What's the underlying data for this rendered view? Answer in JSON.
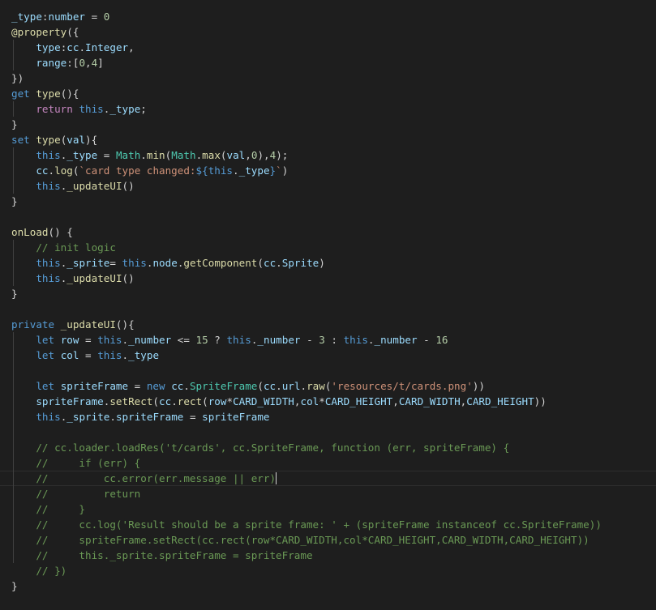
{
  "colors": {
    "default": "#d4d4d4",
    "variable": "#9cdcfe",
    "keyword": "#569cd6",
    "control": "#c586c0",
    "function": "#dcdcaa",
    "type": "#4ec9b0",
    "number": "#b5cea8",
    "string": "#ce9178",
    "comment": "#6a9955"
  },
  "code": {
    "lines": [
      [
        [
          "variable",
          "_type"
        ],
        [
          "default",
          ":"
        ],
        [
          "variable",
          "number"
        ],
        [
          "default",
          " = "
        ],
        [
          "number",
          "0"
        ]
      ],
      [
        [
          "function",
          "@property"
        ],
        [
          "default",
          "({"
        ]
      ],
      [
        [
          "default",
          "    "
        ],
        [
          "variable",
          "type"
        ],
        [
          "default",
          ":"
        ],
        [
          "variable",
          "cc"
        ],
        [
          "default",
          "."
        ],
        [
          "variable",
          "Integer"
        ],
        [
          "default",
          ","
        ]
      ],
      [
        [
          "default",
          "    "
        ],
        [
          "variable",
          "range"
        ],
        [
          "default",
          ":["
        ],
        [
          "number",
          "0"
        ],
        [
          "default",
          ","
        ],
        [
          "number",
          "4"
        ],
        [
          "default",
          "]"
        ]
      ],
      [
        [
          "default",
          "})"
        ]
      ],
      [
        [
          "keyword",
          "get"
        ],
        [
          "default",
          " "
        ],
        [
          "function",
          "type"
        ],
        [
          "default",
          "(){"
        ]
      ],
      [
        [
          "default",
          "    "
        ],
        [
          "control",
          "return"
        ],
        [
          "default",
          " "
        ],
        [
          "keyword",
          "this"
        ],
        [
          "default",
          "."
        ],
        [
          "variable",
          "_type"
        ],
        [
          "default",
          ";"
        ]
      ],
      [
        [
          "default",
          "}"
        ]
      ],
      [
        [
          "keyword",
          "set"
        ],
        [
          "default",
          " "
        ],
        [
          "function",
          "type"
        ],
        [
          "default",
          "("
        ],
        [
          "variable",
          "val"
        ],
        [
          "default",
          "){"
        ]
      ],
      [
        [
          "default",
          "    "
        ],
        [
          "keyword",
          "this"
        ],
        [
          "default",
          "."
        ],
        [
          "variable",
          "_type"
        ],
        [
          "default",
          " = "
        ],
        [
          "type",
          "Math"
        ],
        [
          "default",
          "."
        ],
        [
          "function",
          "min"
        ],
        [
          "default",
          "("
        ],
        [
          "type",
          "Math"
        ],
        [
          "default",
          "."
        ],
        [
          "function",
          "max"
        ],
        [
          "default",
          "("
        ],
        [
          "variable",
          "val"
        ],
        [
          "default",
          ","
        ],
        [
          "number",
          "0"
        ],
        [
          "default",
          "),"
        ],
        [
          "number",
          "4"
        ],
        [
          "default",
          ");"
        ]
      ],
      [
        [
          "default",
          "    "
        ],
        [
          "variable",
          "cc"
        ],
        [
          "default",
          "."
        ],
        [
          "function",
          "log"
        ],
        [
          "default",
          "("
        ],
        [
          "string",
          "`card type changed:"
        ],
        [
          "keyword",
          "${"
        ],
        [
          "keyword",
          "this"
        ],
        [
          "default",
          "."
        ],
        [
          "variable",
          "_type"
        ],
        [
          "keyword",
          "}"
        ],
        [
          "string",
          "`"
        ],
        [
          "default",
          ")"
        ]
      ],
      [
        [
          "default",
          "    "
        ],
        [
          "keyword",
          "this"
        ],
        [
          "default",
          "."
        ],
        [
          "function",
          "_updateUI"
        ],
        [
          "default",
          "()"
        ]
      ],
      [
        [
          "default",
          "}"
        ]
      ],
      [],
      [
        [
          "function",
          "onLoad"
        ],
        [
          "default",
          "() {"
        ]
      ],
      [
        [
          "default",
          "    "
        ],
        [
          "comment",
          "// init logic"
        ]
      ],
      [
        [
          "default",
          "    "
        ],
        [
          "keyword",
          "this"
        ],
        [
          "default",
          "."
        ],
        [
          "variable",
          "_sprite"
        ],
        [
          "default",
          "= "
        ],
        [
          "keyword",
          "this"
        ],
        [
          "default",
          "."
        ],
        [
          "variable",
          "node"
        ],
        [
          "default",
          "."
        ],
        [
          "function",
          "getComponent"
        ],
        [
          "default",
          "("
        ],
        [
          "variable",
          "cc"
        ],
        [
          "default",
          "."
        ],
        [
          "variable",
          "Sprite"
        ],
        [
          "default",
          ")"
        ]
      ],
      [
        [
          "default",
          "    "
        ],
        [
          "keyword",
          "this"
        ],
        [
          "default",
          "."
        ],
        [
          "function",
          "_updateUI"
        ],
        [
          "default",
          "()"
        ]
      ],
      [
        [
          "default",
          "}"
        ]
      ],
      [],
      [
        [
          "keyword",
          "private"
        ],
        [
          "default",
          " "
        ],
        [
          "function",
          "_updateUI"
        ],
        [
          "default",
          "(){"
        ]
      ],
      [
        [
          "default",
          "    "
        ],
        [
          "keyword",
          "let"
        ],
        [
          "default",
          " "
        ],
        [
          "variable",
          "row"
        ],
        [
          "default",
          " = "
        ],
        [
          "keyword",
          "this"
        ],
        [
          "default",
          "."
        ],
        [
          "variable",
          "_number"
        ],
        [
          "default",
          " <= "
        ],
        [
          "number",
          "15"
        ],
        [
          "default",
          " ? "
        ],
        [
          "keyword",
          "this"
        ],
        [
          "default",
          "."
        ],
        [
          "variable",
          "_number"
        ],
        [
          "default",
          " - "
        ],
        [
          "number",
          "3"
        ],
        [
          "default",
          " : "
        ],
        [
          "keyword",
          "this"
        ],
        [
          "default",
          "."
        ],
        [
          "variable",
          "_number"
        ],
        [
          "default",
          " - "
        ],
        [
          "number",
          "16"
        ]
      ],
      [
        [
          "default",
          "    "
        ],
        [
          "keyword",
          "let"
        ],
        [
          "default",
          " "
        ],
        [
          "variable",
          "col"
        ],
        [
          "default",
          " = "
        ],
        [
          "keyword",
          "this"
        ],
        [
          "default",
          "."
        ],
        [
          "variable",
          "_type"
        ]
      ],
      [],
      [
        [
          "default",
          "    "
        ],
        [
          "keyword",
          "let"
        ],
        [
          "default",
          " "
        ],
        [
          "variable",
          "spriteFrame"
        ],
        [
          "default",
          " = "
        ],
        [
          "keyword",
          "new"
        ],
        [
          "default",
          " "
        ],
        [
          "variable",
          "cc"
        ],
        [
          "default",
          "."
        ],
        [
          "type",
          "SpriteFrame"
        ],
        [
          "default",
          "("
        ],
        [
          "variable",
          "cc"
        ],
        [
          "default",
          "."
        ],
        [
          "variable",
          "url"
        ],
        [
          "default",
          "."
        ],
        [
          "function",
          "raw"
        ],
        [
          "default",
          "("
        ],
        [
          "string",
          "'resources/t/cards.png'"
        ],
        [
          "default",
          "))"
        ]
      ],
      [
        [
          "default",
          "    "
        ],
        [
          "variable",
          "spriteFrame"
        ],
        [
          "default",
          "."
        ],
        [
          "function",
          "setRect"
        ],
        [
          "default",
          "("
        ],
        [
          "variable",
          "cc"
        ],
        [
          "default",
          "."
        ],
        [
          "function",
          "rect"
        ],
        [
          "default",
          "("
        ],
        [
          "variable",
          "row"
        ],
        [
          "default",
          "*"
        ],
        [
          "variable",
          "CARD_WIDTH"
        ],
        [
          "default",
          ","
        ],
        [
          "variable",
          "col"
        ],
        [
          "default",
          "*"
        ],
        [
          "variable",
          "CARD_HEIGHT"
        ],
        [
          "default",
          ","
        ],
        [
          "variable",
          "CARD_WIDTH"
        ],
        [
          "default",
          ","
        ],
        [
          "variable",
          "CARD_HEIGHT"
        ],
        [
          "default",
          "))"
        ]
      ],
      [
        [
          "default",
          "    "
        ],
        [
          "keyword",
          "this"
        ],
        [
          "default",
          "."
        ],
        [
          "variable",
          "_sprite"
        ],
        [
          "default",
          "."
        ],
        [
          "variable",
          "spriteFrame"
        ],
        [
          "default",
          " = "
        ],
        [
          "variable",
          "spriteFrame"
        ]
      ],
      [],
      [
        [
          "default",
          "    "
        ],
        [
          "comment",
          "// cc.loader.loadRes('t/cards', cc.SpriteFrame, function (err, spriteFrame) {"
        ]
      ],
      [
        [
          "default",
          "    "
        ],
        [
          "comment",
          "//     if (err) {"
        ]
      ],
      [
        [
          "default",
          "    "
        ],
        [
          "comment",
          "//         cc.error(err.message || err)"
        ]
      ],
      [
        [
          "default",
          "    "
        ],
        [
          "comment",
          "//         return"
        ]
      ],
      [
        [
          "default",
          "    "
        ],
        [
          "comment",
          "//     }"
        ]
      ],
      [
        [
          "default",
          "    "
        ],
        [
          "comment",
          "//     cc.log('Result should be a sprite frame: ' + (spriteFrame instanceof cc.SpriteFrame))"
        ]
      ],
      [
        [
          "default",
          "    "
        ],
        [
          "comment",
          "//     spriteFrame.setRect(cc.rect(row*CARD_WIDTH,col*CARD_HEIGHT,CARD_WIDTH,CARD_HEIGHT))"
        ]
      ],
      [
        [
          "default",
          "    "
        ],
        [
          "comment",
          "//     this._sprite.spriteFrame = spriteFrame"
        ]
      ],
      [
        [
          "default",
          "    "
        ],
        [
          "comment",
          "// })"
        ]
      ],
      [
        [
          "default",
          "}"
        ]
      ]
    ]
  }
}
